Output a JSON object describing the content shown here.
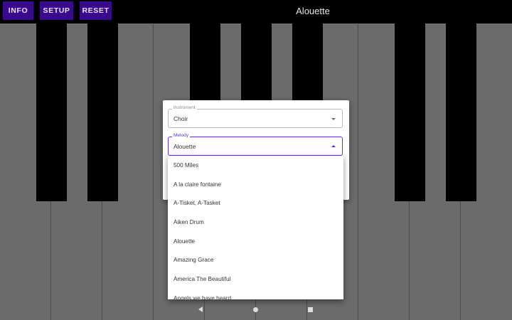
{
  "toolbar": {
    "info_label": "INFO",
    "setup_label": "SETUP",
    "reset_label": "RESET"
  },
  "song_title": "Alouette",
  "colors": {
    "toolbar_button": "#3a0a8c",
    "accent": "#5e2ed8",
    "white_key": "#6b6b6b",
    "black_key": "#000000"
  },
  "dialog": {
    "instrument": {
      "label": "Instrument",
      "value": "Choir"
    },
    "melody": {
      "label": "Melody",
      "value": "Alouette"
    }
  },
  "melody_options": [
    "500 Miles",
    "A la claire fontaine",
    "A-Tisket, A-Tasket",
    "Aiken Drum",
    "Alouette",
    "Amazing Grace",
    "America The Beautiful",
    "Angels we have heard"
  ],
  "navbar": {
    "back_icon": "back-triangle-icon",
    "home_icon": "home-circle-icon",
    "recent_icon": "recents-square-icon"
  }
}
